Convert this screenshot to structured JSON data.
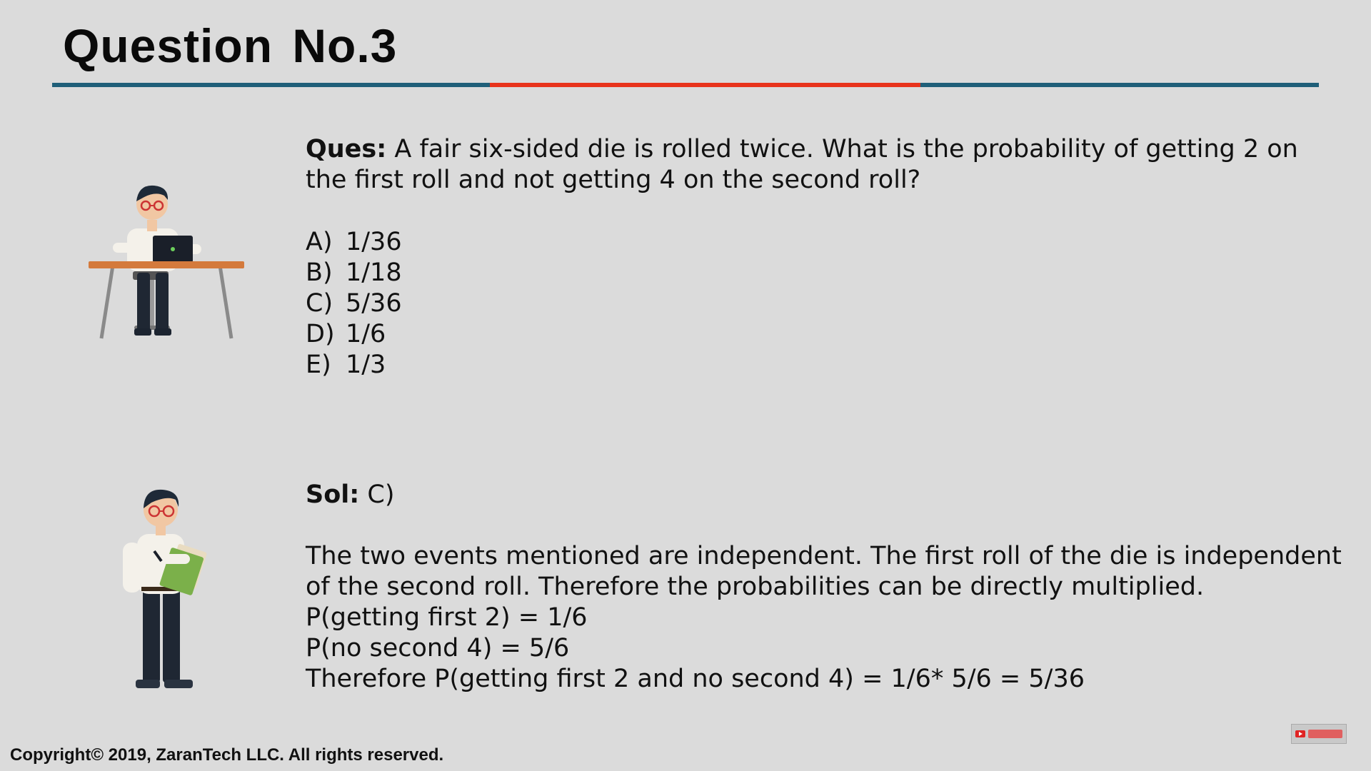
{
  "header": {
    "title": "Question No.3"
  },
  "question": {
    "label": "Ques:",
    "text": " A fair six-sided die is rolled twice. What is the probability of getting 2 on the first roll and not getting 4 on the second roll?",
    "options": [
      {
        "letter": "A)",
        "value": "1/36"
      },
      {
        "letter": "B)",
        "value": "1/18"
      },
      {
        "letter": "C)",
        "value": "5/36"
      },
      {
        "letter": "D)",
        "value": "1/6"
      },
      {
        "letter": "E)",
        "value": "1/3"
      }
    ]
  },
  "solution": {
    "label": "Sol:",
    "answer": " C)",
    "lines": [
      "The two events mentioned are independent. The first roll of the die is independent",
      "of the second roll. Therefore the probabilities can be directly multiplied.",
      "P(getting first 2) = 1/6",
      "P(no second 4) = 5/6",
      "Therefore P(getting first 2 and no second 4) = 1/6* 5/6 = 5/36"
    ]
  },
  "footer": {
    "copyright": "Copyright© 2019, ZaranTech LLC. All rights reserved."
  },
  "colors": {
    "background": "#dbdbdb",
    "rule": "#1f5f79",
    "rule_accent": "#e8331c"
  },
  "icons": {
    "desk_illustration": "person-at-desk-with-laptop-illustration",
    "clipboard_illustration": "person-with-clipboard-illustration",
    "subscribe": "subscribe-icon"
  }
}
